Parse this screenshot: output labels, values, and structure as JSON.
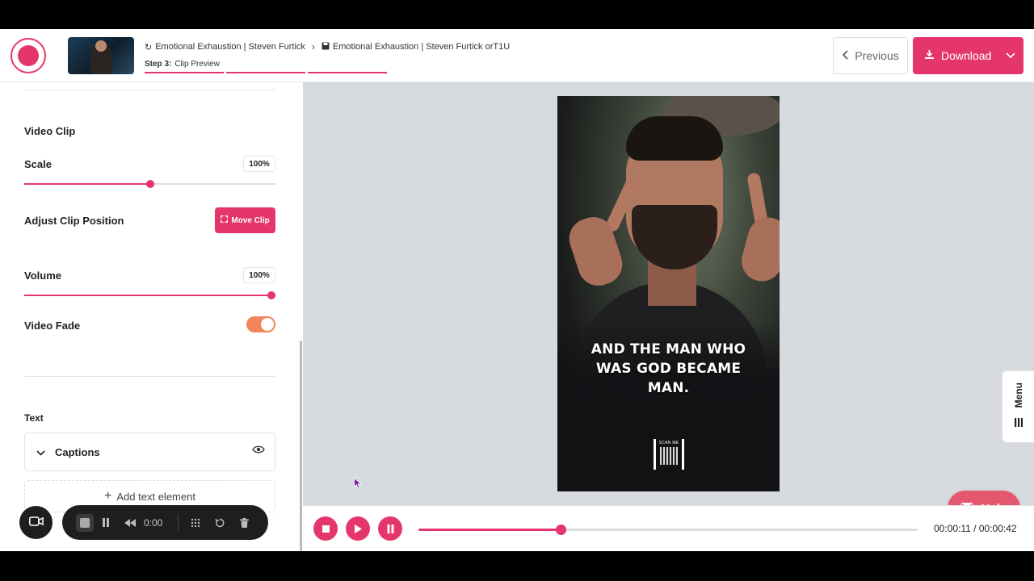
{
  "header": {
    "breadcrumb": [
      {
        "icon": "refresh-icon",
        "label": "Emotional Exhaustion | Steven Furtick"
      },
      {
        "icon": "save-icon",
        "label": "Emotional Exhaustion | Steven Furtick orT1U"
      }
    ],
    "step_label": "Step 3:",
    "step_name": "Clip Preview",
    "previous_label": "Previous",
    "download_label": "Download"
  },
  "sidebar": {
    "video_clip_title": "Video Clip",
    "scale_label": "Scale",
    "scale_value": "100%",
    "scale_level": 0.5,
    "adjust_position_label": "Adjust Clip Position",
    "move_clip_label": "Move Clip",
    "volume_label": "Volume",
    "volume_value": "100%",
    "volume_level": 1.0,
    "video_fade_label": "Video Fade",
    "video_fade_on": true,
    "text_title": "Text",
    "captions_label": "Captions",
    "add_text_label": "Add text element"
  },
  "recorder": {
    "time": "0:00"
  },
  "preview": {
    "caption_lines": [
      "AND THE MAN WHO",
      "WAS GOD BECAME",
      "MAN."
    ],
    "qr_label": "SCAN ME"
  },
  "menu_label": "Menu",
  "help_label": "Help",
  "player": {
    "current_time": "00:00:11",
    "total_time": "00:00:42",
    "progress": 0.285
  },
  "colors": {
    "accent": "#e5366b",
    "toggle": "#f2855a",
    "help": "#e5566f"
  }
}
